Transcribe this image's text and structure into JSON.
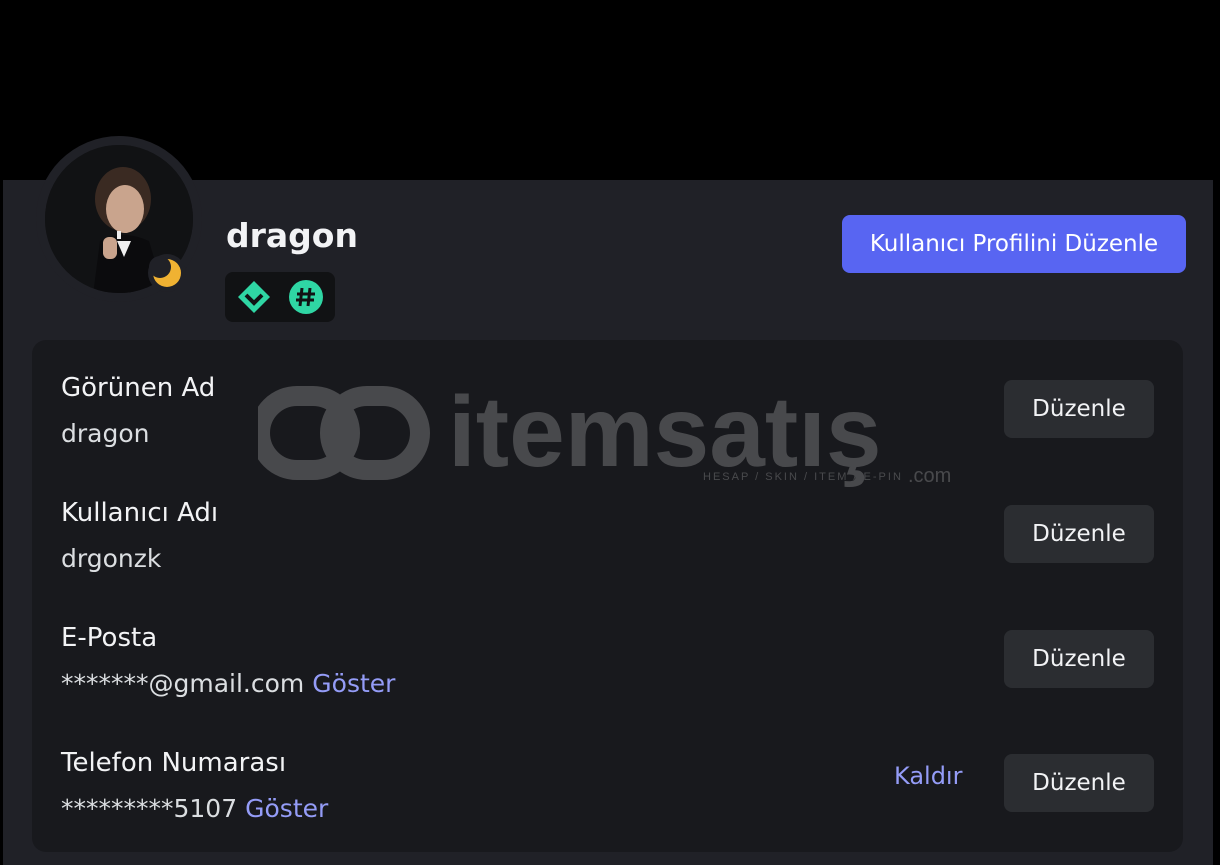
{
  "profile": {
    "display_name": "dragon",
    "edit_profile_label": "Kullanıcı Profilini Düzenle",
    "status": "idle-moon-icon",
    "badges": [
      "hypesquad-diamond-icon",
      "hashtag-badge-icon"
    ]
  },
  "fields": [
    {
      "label": "Görünen Ad",
      "value": "dragon",
      "show": "",
      "edit": "Düzenle"
    },
    {
      "label": "Kullanıcı Adı",
      "value": "drgonzk",
      "show": "",
      "edit": "Düzenle"
    },
    {
      "label": "E-Posta",
      "value": "*******@gmail.com",
      "show": "Göster",
      "edit": "Düzenle"
    },
    {
      "label": "Telefon Numarası",
      "value": "*********5107",
      "show": "Göster",
      "remove": "Kaldır",
      "edit": "Düzenle"
    }
  ],
  "watermark": {
    "brand": "itemsatış",
    "tagline": "HESAP / SKIN / ITEM / E-PIN",
    "suffix": ".com"
  },
  "colors": {
    "accent": "#5865f2",
    "link": "#949cf7",
    "badge_green": "#23a559"
  }
}
